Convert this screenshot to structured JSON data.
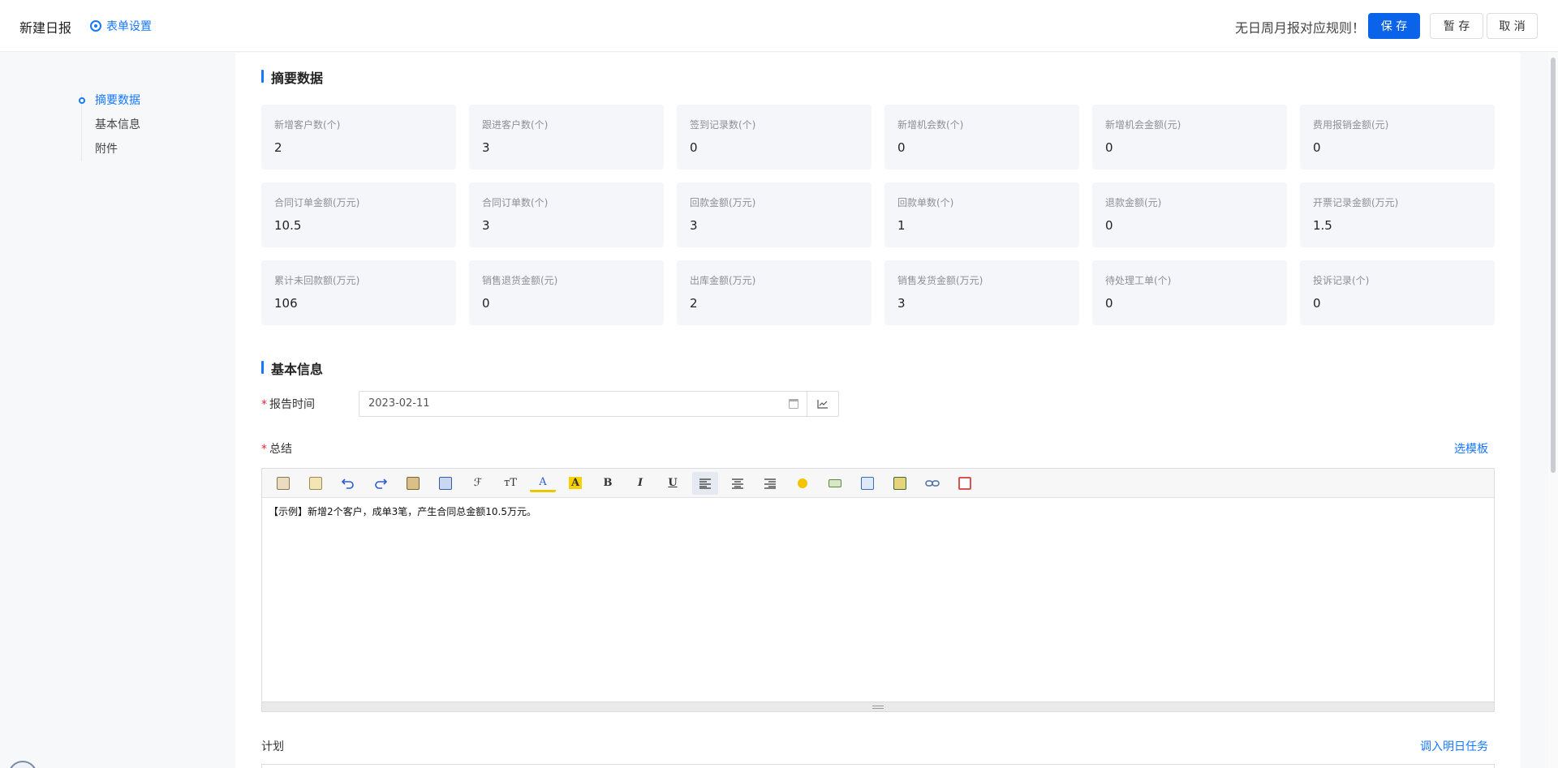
{
  "header": {
    "title": "新建日报",
    "form_settings": "表单设置",
    "rule_text": "无日周月报对应规则！",
    "save": "保 存",
    "draft": "暂 存",
    "cancel": "取 消"
  },
  "nav": {
    "items": [
      {
        "label": "摘要数据"
      },
      {
        "label": "基本信息"
      },
      {
        "label": "附件"
      }
    ]
  },
  "summary": {
    "title": "摘要数据",
    "cards": [
      {
        "label": "新增客户数(个)",
        "value": "2"
      },
      {
        "label": "跟进客户数(个)",
        "value": "3"
      },
      {
        "label": "签到记录数(个)",
        "value": "0"
      },
      {
        "label": "新增机会数(个)",
        "value": "0"
      },
      {
        "label": "新增机会金额(元)",
        "value": "0"
      },
      {
        "label": "费用报销金额(元)",
        "value": "0"
      },
      {
        "label": "合同订单金额(万元)",
        "value": "10.5"
      },
      {
        "label": "合同订单数(个)",
        "value": "3"
      },
      {
        "label": "回款金额(万元)",
        "value": "3"
      },
      {
        "label": "回款单数(个)",
        "value": "1"
      },
      {
        "label": "退款金额(元)",
        "value": "0"
      },
      {
        "label": "开票记录金额(万元)",
        "value": "1.5"
      },
      {
        "label": "累计未回款额(万元)",
        "value": "106"
      },
      {
        "label": "销售退货金额(元)",
        "value": "0"
      },
      {
        "label": "出库金额(万元)",
        "value": "2"
      },
      {
        "label": "销售发货金额(万元)",
        "value": "3"
      },
      {
        "label": "待处理工单(个)",
        "value": "0"
      },
      {
        "label": "投诉记录(个)",
        "value": "0"
      }
    ]
  },
  "basic": {
    "title": "基本信息",
    "report_time_label": "报告时间",
    "report_time_value": "2023-02-11",
    "summary_label": "总结",
    "choose_template": "选模板",
    "summary_text": "【示例】新增2个客户，成单3笔，产生合同总金额10.5万元。",
    "plan_label": "计划",
    "import_tasks": "调入明日任务",
    "required_mark": "*"
  },
  "toolbar": {
    "bold": "B",
    "italic": "I",
    "underline": "U",
    "font_size": "тT",
    "font_family": "ℱ"
  },
  "colors": {
    "accent": "#1677ff",
    "primary_button": "#0a63e8",
    "required": "#f5222d"
  }
}
